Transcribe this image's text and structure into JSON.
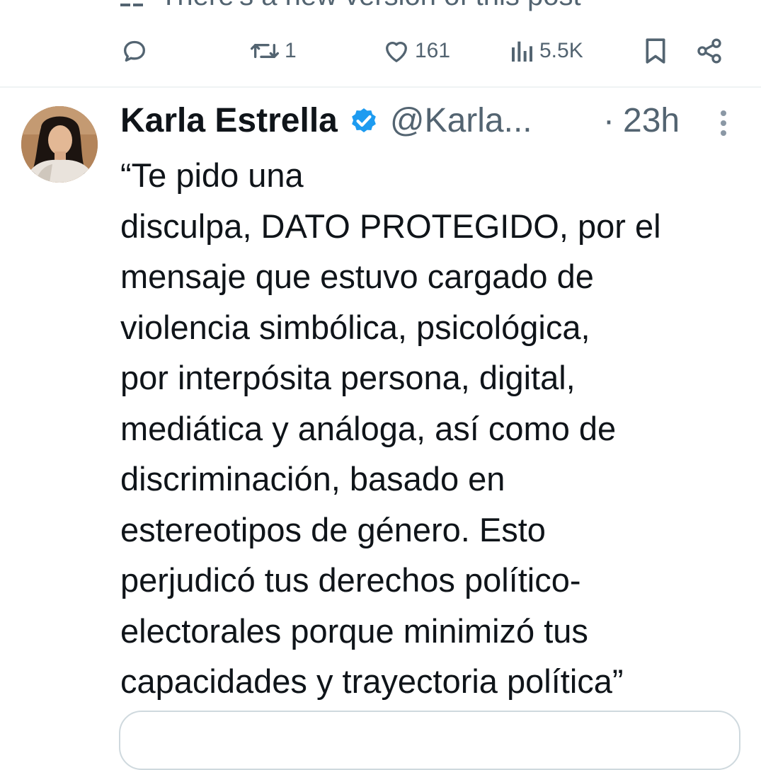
{
  "previous_post": {
    "notice_text": "There's a new version of this post",
    "actions": {
      "reply_count": "",
      "repost_count": "1",
      "like_count": "161",
      "views_count": "5.5K"
    }
  },
  "post": {
    "author": {
      "display_name": "Karla Estrella",
      "handle": "@Karla...",
      "verified": true
    },
    "time_separator": "·",
    "timestamp": "23h",
    "text_lines": [
      "“Te pido una",
      "disculpa, DATO PROTEGIDO, por el",
      "mensaje que estuvo cargado de",
      "violencia simbólica, psicológica,",
      "por interpósita persona, digital,",
      "mediática y análoga, así como de",
      "discriminación, basado en",
      "estereotipos de género. Esto",
      "perjudicó tus derechos político-",
      "electorales porque minimizó tus",
      "capacidades y trayectoria política”"
    ]
  },
  "colors": {
    "text_primary": "#0f1419",
    "text_secondary": "#536471",
    "verified_blue": "#1d9bf0",
    "divider": "#eff3f4",
    "card_border": "#cfd9de"
  },
  "icons": [
    "edit-history-icon",
    "reply-icon",
    "repost-icon",
    "like-icon",
    "views-icon",
    "bookmark-icon",
    "share-icon",
    "verified-badge-icon",
    "more-options-icon"
  ]
}
